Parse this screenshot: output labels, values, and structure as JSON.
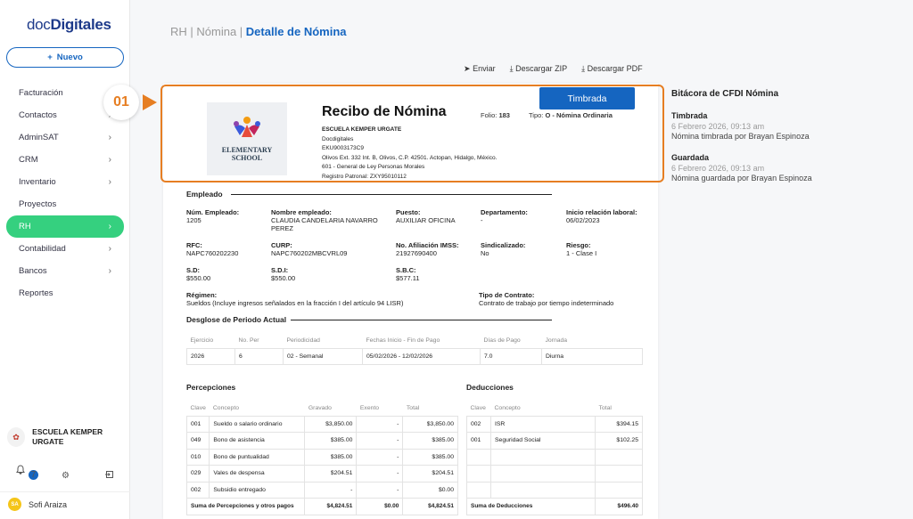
{
  "app": {
    "logo_light": "doc",
    "logo_bold": "Digitales",
    "new_button": "Nuevo"
  },
  "nav": [
    {
      "label": "Facturación",
      "chev": ""
    },
    {
      "label": "Contactos",
      "chev": "›"
    },
    {
      "label": "AdminSAT",
      "chev": "›"
    },
    {
      "label": "CRM",
      "chev": "›"
    },
    {
      "label": "Inventario",
      "chev": "›"
    },
    {
      "label": "Proyectos",
      "chev": ""
    },
    {
      "label": "RH",
      "chev": "›"
    },
    {
      "label": "Contabilidad",
      "chev": "›"
    },
    {
      "label": "Bancos",
      "chev": "›"
    },
    {
      "label": "Reportes",
      "chev": ""
    }
  ],
  "org": {
    "name": "ESCUELA KEMPER URGATE",
    "notifications": "7"
  },
  "user": {
    "initials": "SA",
    "name": "Sofi Araiza"
  },
  "breadcrumb": {
    "a": "RH",
    "b": "Nómina",
    "current": "Detalle de Nómina",
    "sep": " | "
  },
  "actions": {
    "send": "Enviar",
    "zip": "Descargar ZIP",
    "pdf": "Descargar PDF"
  },
  "step": "01",
  "receipt": {
    "status": "Timbrada",
    "title": "Recibo de Nómina",
    "folio_label": "Folio:",
    "folio": "183",
    "tipo_label": "Tipo:",
    "tipo": "O - Nómina Ordinaria",
    "school_logo_line1": "ELEMENTARY",
    "school_logo_line2": "SCHOOL",
    "emisor": [
      "ESCUELA KEMPER URGATE",
      "Docdigitales",
      "EKU9003173C9",
      "Olivos Ext. 332 Int. B, Olivos, C.P. 42501. Actopan, Hidalgo, México.",
      "601 - General de Ley Personas Morales",
      "Registro Patronal: ZXY95010112"
    ]
  },
  "empleado": {
    "section": "Empleado",
    "num_label": "Núm. Empleado:",
    "num": "1205",
    "nombre_label": "Nombre empleado:",
    "nombre": "CLAUDIA CANDELARIA NAVARRO PEREZ",
    "puesto_label": "Puesto:",
    "puesto": "AUXILIAR OFICINA",
    "depto_label": "Departamento:",
    "depto": "-",
    "inicio_label": "Inicio relación laboral:",
    "inicio": "06/02/2023",
    "rfc_label": "RFC:",
    "rfc": "NAPC760202230",
    "curp_label": "CURP:",
    "curp": "NAPC760202MBCVRL09",
    "imss_label": "No. Afiliación IMSS:",
    "imss": "21927690400",
    "sind_label": "Sindicalizado:",
    "sind": "No",
    "riesgo_label": "Riesgo:",
    "riesgo": "1 - Clase I",
    "sd_label": "S.D:",
    "sd": "$550.00",
    "sdi_label": "S.D.I:",
    "sdi": "$550.00",
    "sbc_label": "S.B.C:",
    "sbc": "$577.11",
    "regimen_label": "Régimen:",
    "regimen": "Sueldos (Incluye ingresos señalados en la fracción I del artículo 94 LISR)",
    "contrato_label": "Tipo de Contrato:",
    "contrato": "Contrato de trabajo por tiempo indeterminado"
  },
  "periodo": {
    "section": "Desglose de Periodo Actual",
    "headers": [
      "Ejercicio",
      "No. Per",
      "Periodicidad",
      "Fechas Inicio - Fin de Pago",
      "Días de Pago",
      "Jornada"
    ],
    "row": [
      "2026",
      "6",
      "02 - Semanal",
      "05/02/2026 - 12/02/2026",
      "7.0",
      "Diurna"
    ]
  },
  "percepciones": {
    "section": "Percepciones",
    "headers": [
      "Clave",
      "Concepto",
      "Gravado",
      "Exento",
      "Total"
    ],
    "rows": [
      [
        "001",
        "Sueldo o salario ordinario",
        "$3,850.00",
        "-",
        "$3,850.00"
      ],
      [
        "049",
        "Bono de asistencia",
        "$385.00",
        "-",
        "$385.00"
      ],
      [
        "010",
        "Bono de puntualidad",
        "$385.00",
        "-",
        "$385.00"
      ],
      [
        "029",
        "Vales de despensa",
        "$204.51",
        "-",
        "$204.51"
      ],
      [
        "002",
        "Subsidio entregado",
        "-",
        "-",
        "$0.00"
      ]
    ],
    "sum_label": "Suma de Percepciones y otros pagos",
    "sum_gravado": "$4,824.51",
    "sum_exento": "$0.00",
    "sum_total": "$4,824.51"
  },
  "deducciones": {
    "section": "Deducciones",
    "headers": [
      "Clave",
      "Concepto",
      "Total"
    ],
    "rows": [
      [
        "002",
        "ISR",
        "$394.15"
      ],
      [
        "001",
        "Seguridad Social",
        "$102.25"
      ]
    ],
    "sum_label": "Suma de Deducciones",
    "sum_total": "$496.40"
  },
  "bitacora": {
    "title": "Bitácora de CFDI Nómina",
    "items": [
      {
        "title": "Timbrada",
        "date": "6 Febrero 2026, 09:13 am",
        "text": "Nómina timbrada por Brayan Espinoza"
      },
      {
        "title": "Guardada",
        "date": "6 Febrero 2026, 09:13 am",
        "text": "Nómina guardada por Brayan Espinoza"
      }
    ]
  }
}
